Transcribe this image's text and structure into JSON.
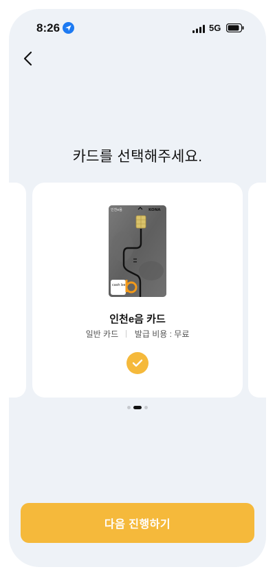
{
  "status_bar": {
    "time": "8:26",
    "network": "5G"
  },
  "header": {
    "back_label": ""
  },
  "page": {
    "title": "카드를 선택해주세요."
  },
  "card": {
    "image_text": {
      "brand_left": "인천e음",
      "brand_right": "KONA",
      "cashbee": "cash bee"
    },
    "name": "인천e음 카드",
    "type": "일반 카드",
    "fee": "발급 비용 : 무료",
    "selected": true
  },
  "carousel": {
    "total": 3,
    "active_index": 1
  },
  "cta": {
    "label": "다음 진행하기"
  },
  "colors": {
    "accent": "#f5b93b",
    "background": "#eef2f7"
  }
}
